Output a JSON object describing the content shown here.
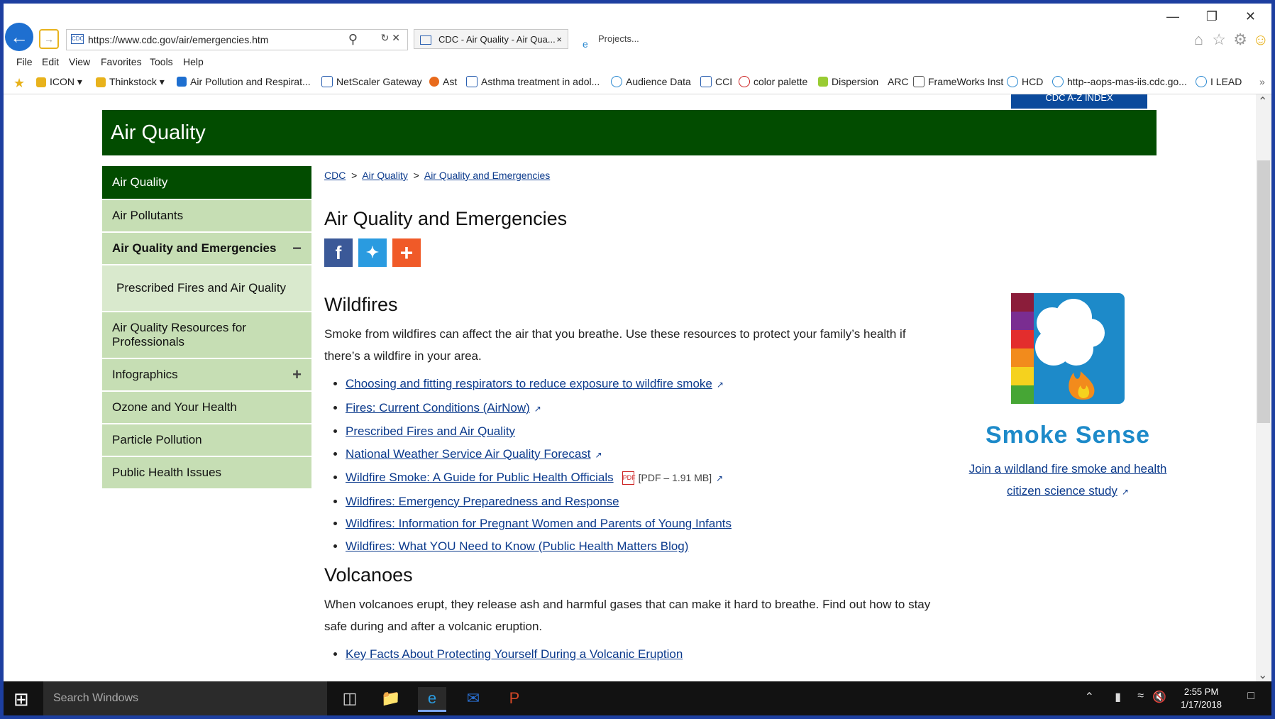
{
  "browser": {
    "url": "https://www.cdc.gov/air/emergencies.htm",
    "tab1_title": "CDC - Air Quality - Air Qua...",
    "tab2_title": "Projects...",
    "menu": [
      "File",
      "Edit",
      "View",
      "Favorites",
      "Tools",
      "Help"
    ],
    "favorites": [
      {
        "label": "ICON ▾"
      },
      {
        "label": "Thinkstock ▾"
      },
      {
        "label": "Air Pollution and Respirat..."
      },
      {
        "label": "NetScaler Gateway"
      },
      {
        "label": "Ast"
      },
      {
        "label": "Asthma treatment in adol..."
      },
      {
        "label": "Audience Data"
      },
      {
        "label": "CCI"
      },
      {
        "label": "color palette"
      },
      {
        "label": "Dispersion"
      },
      {
        "label": "ARC"
      },
      {
        "label": "FrameWorks Inst"
      },
      {
        "label": "HCD"
      },
      {
        "label": "http--aops-mas-iis.cdc.go..."
      },
      {
        "label": "I LEAD"
      }
    ]
  },
  "site": {
    "az_label": "CDC A-Z INDEX",
    "banner_title": "Air Quality"
  },
  "sidenav": [
    {
      "label": "Air Quality",
      "state": "active",
      "sign": ""
    },
    {
      "label": "Air Pollutants",
      "state": "",
      "sign": ""
    },
    {
      "label": "Air Quality and Emergencies",
      "state": "open",
      "sign": "−"
    },
    {
      "label": "Prescribed Fires and Air Quality",
      "state": "sub",
      "sign": ""
    },
    {
      "label": "Air Quality Resources for Professionals",
      "state": "",
      "sign": ""
    },
    {
      "label": "Infographics",
      "state": "",
      "sign": "+"
    },
    {
      "label": "Ozone and Your Health",
      "state": "",
      "sign": ""
    },
    {
      "label": "Particle Pollution",
      "state": "",
      "sign": ""
    },
    {
      "label": "Public Health Issues",
      "state": "",
      "sign": ""
    }
  ],
  "content": {
    "breadcrumb": [
      "CDC",
      "Air Quality",
      "Air Quality and Emergencies"
    ],
    "page_title": "Air Quality and Emergencies",
    "wildfires_heading": "Wildfires",
    "wildfires_text": "Smoke from wildfires can affect the air that you breathe. Use these resources to protect your family’s health if there’s a wildfire in your area.",
    "wildfire_links": [
      {
        "label": "Choosing and fitting respirators to reduce exposure to wildfire smoke",
        "external": true
      },
      {
        "label": "Fires: Current Conditions (AirNow)",
        "external": true
      },
      {
        "label": "Prescribed Fires and Air Quality",
        "external": false
      },
      {
        "label": "National Weather Service Air Quality Forecast",
        "external": true
      },
      {
        "label": "Wildfire Smoke: A Guide for Public Health Officials",
        "external": true,
        "pdf": "[PDF – 1.91 MB]"
      },
      {
        "label": "Wildfires: Emergency Preparedness and Response",
        "external": false
      },
      {
        "label": "Wildfires: Information for Pregnant Women and Parents of Young Infants",
        "external": false
      },
      {
        "label": "Wildfires: What YOU Need to Know (Public Health Matters Blog)",
        "external": false
      }
    ],
    "volcanoes_heading": "Volcanoes",
    "volcanoes_text": "When volcanoes erupt, they release ash and harmful gases that can make it hard to breathe. Find out how to stay safe during and after a volcanic eruption.",
    "volcano_links": [
      {
        "label": "Key Facts About Protecting Yourself During a Volcanic Eruption"
      }
    ]
  },
  "promo": {
    "title": "Smoke Sense",
    "link": "Join a wildland fire smoke and health citizen science study"
  },
  "taskbar": {
    "search_placeholder": "Search Windows",
    "time": "2:55 PM",
    "date": "1/17/2018"
  },
  "colors": {
    "banner": "#024c00",
    "nav_bg": "#c6deb4",
    "link": "#0b3a8c",
    "promo_blue": "#1d8ac9"
  }
}
